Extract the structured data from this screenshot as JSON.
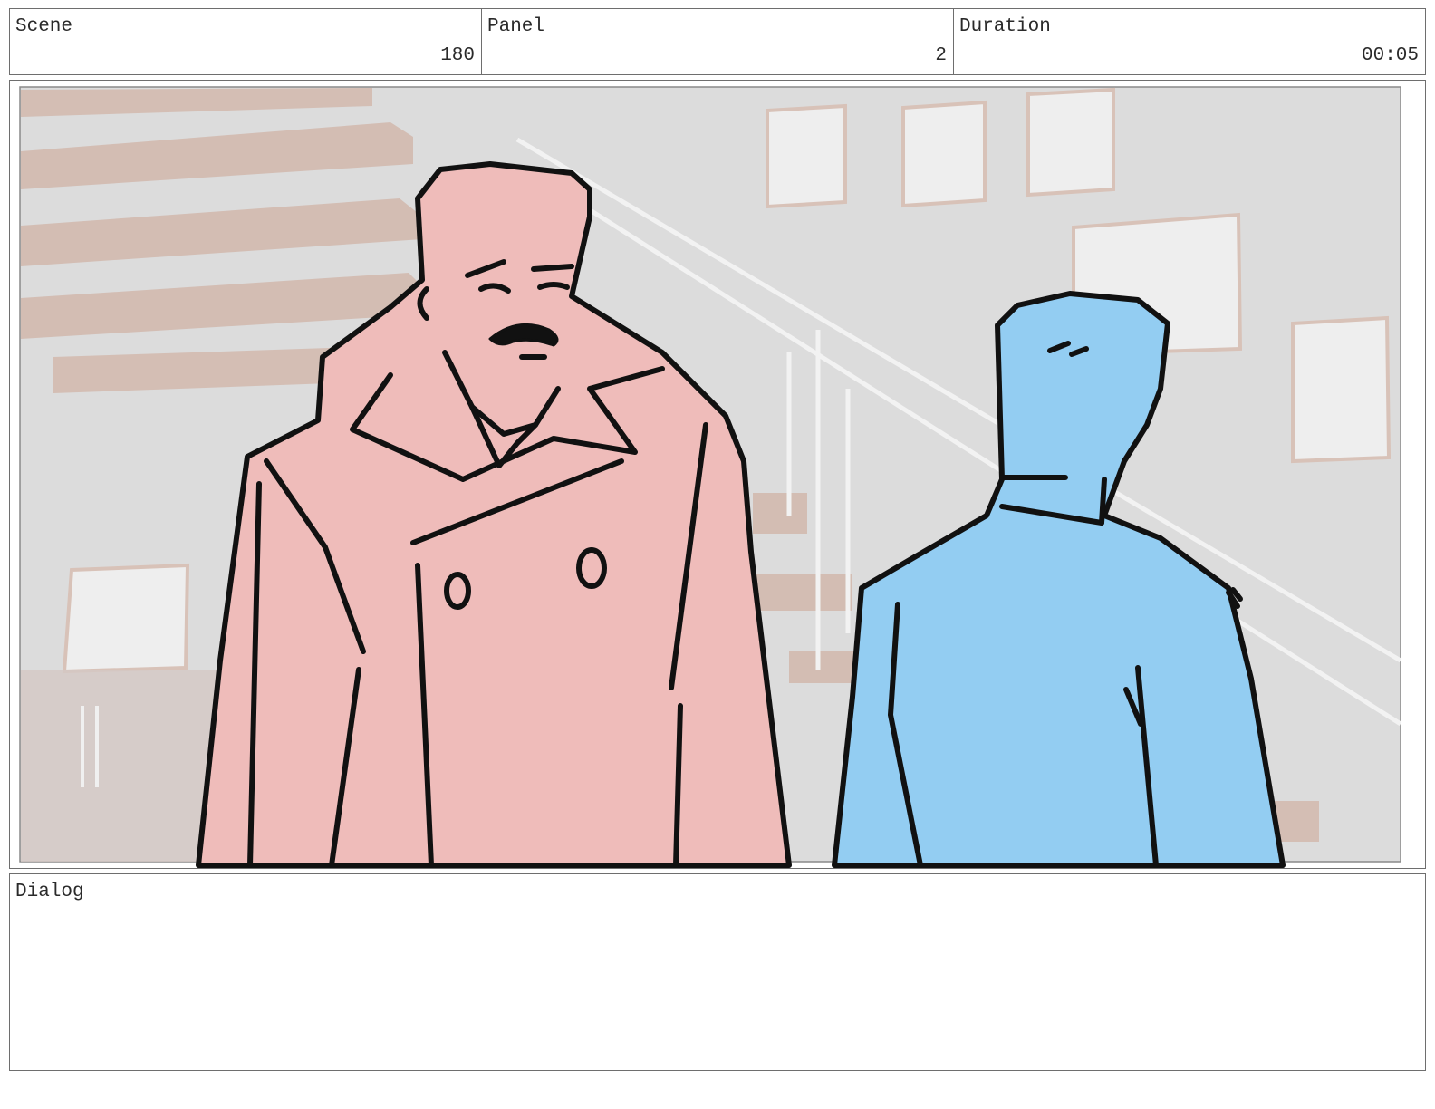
{
  "header": {
    "scene_label": "Scene",
    "scene_value": "180",
    "panel_label": "Panel",
    "panel_value": "2",
    "duration_label": "Duration",
    "duration_value": "00:05"
  },
  "dialog": {
    "label": "Dialog"
  },
  "artwork": {
    "description_icon": "storyboard-drawing-icon",
    "colors": {
      "background_wall": "#dcdcdc",
      "stairs": "#d2b8ad",
      "character_a_fill": "#efbcba",
      "character_b_fill": "#93cdf2",
      "ink": "#111111"
    }
  }
}
